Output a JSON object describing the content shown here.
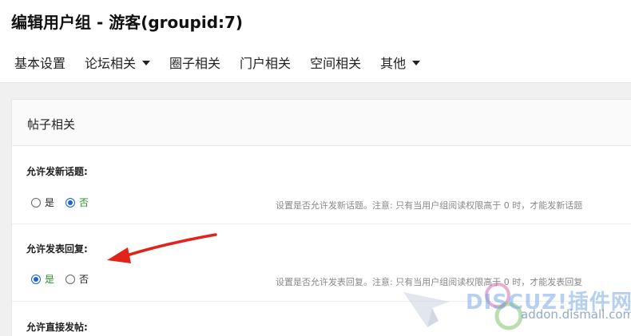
{
  "header": {
    "title": "编辑用户组 - 游客(groupid:7)",
    "tabs": [
      {
        "label": "基本设置",
        "has_dropdown": false
      },
      {
        "label": "论坛相关",
        "has_dropdown": true
      },
      {
        "label": "圈子相关",
        "has_dropdown": false
      },
      {
        "label": "门户相关",
        "has_dropdown": false
      },
      {
        "label": "空间相关",
        "has_dropdown": false
      },
      {
        "label": "其他",
        "has_dropdown": true
      }
    ]
  },
  "panel": {
    "title": "帖子相关",
    "settings": [
      {
        "title": "允许发新话题:",
        "options": [
          "是",
          "否"
        ],
        "selected": "否",
        "hint": "设置是否允许发新话题。注意: 只有当用户组阅读权限高于 0 时，才能发新话题"
      },
      {
        "title": "允许发表回复:",
        "options": [
          "是",
          "否"
        ],
        "selected": "是",
        "hint": "设置是否允许发表回复。注意: 只有当用户组阅读权限高于 0 时，才能发表回复"
      },
      {
        "title": "允许直接发帖:"
      }
    ]
  },
  "watermark": {
    "brand": "DISCUZ!插件网",
    "domain": "addon.dismall.com"
  },
  "colors": {
    "accent": "#1a64d6",
    "selected_label": "#2e8b2e",
    "annotation_arrow": "#e2231a"
  },
  "icons": {
    "tab_dropdown": "caret-down-icon",
    "annotation": "red-arrow-icon"
  }
}
